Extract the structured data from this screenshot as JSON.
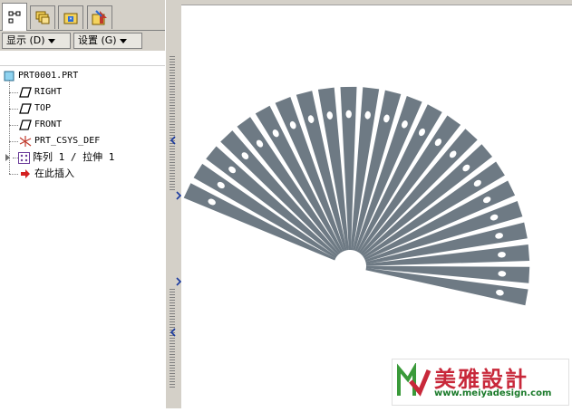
{
  "tabs": [
    {
      "icon": "model-tree-icon",
      "active": true
    },
    {
      "icon": "layers-icon",
      "active": false
    },
    {
      "icon": "folder-browser-icon",
      "active": false
    },
    {
      "icon": "favorites-icon",
      "active": false
    }
  ],
  "menu": {
    "show_label": "显示 (D)",
    "settings_label": "设置 (G)"
  },
  "tree": {
    "root": "PRT0001.PRT",
    "items": [
      {
        "label": "RIGHT",
        "icon": "datum-plane-icon"
      },
      {
        "label": "TOP",
        "icon": "datum-plane-icon"
      },
      {
        "label": "FRONT",
        "icon": "datum-plane-icon"
      },
      {
        "label": "PRT_CSYS_DEF",
        "icon": "coordinate-system-icon"
      },
      {
        "label": "阵列 1 / 拉伸 1",
        "icon": "pattern-icon"
      },
      {
        "label": "在此插入",
        "icon": "insert-here-arrow-icon"
      }
    ]
  },
  "model": {
    "blade_color": "#6e7a84",
    "blade_count": 24,
    "hole_color": "#ffffff"
  },
  "watermark": {
    "brand_text": "美雅設計",
    "url_text": "www.meiyadesign.com",
    "brand_color": "#c8283a",
    "green_color": "#3a9a3a"
  }
}
